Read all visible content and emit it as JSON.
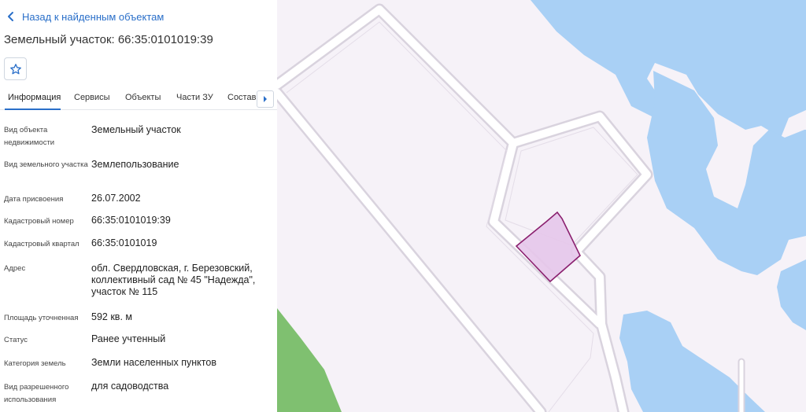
{
  "nav": {
    "back_label": "Назад к найденным объектам"
  },
  "object": {
    "title": "Земельный участок: 66:35:0101019:39"
  },
  "tabs": [
    {
      "label": "Информация",
      "active": true
    },
    {
      "label": "Сервисы"
    },
    {
      "label": "Объекты"
    },
    {
      "label": "Части ЗУ"
    },
    {
      "label": "Состав"
    }
  ],
  "info": [
    {
      "label": "Вид объекта недвижимости",
      "value": "Земельный участок"
    },
    {
      "label": "Вид земельного участка",
      "value": "Землепользование"
    },
    {
      "label": "Дата присвоения",
      "value": "26.07.2002"
    },
    {
      "label": "Кадастровый номер",
      "value": "66:35:0101019:39"
    },
    {
      "label": "Кадастровый квартал",
      "value": "66:35:0101019"
    },
    {
      "label": "Адрес",
      "value": "обл. Свердловская, г. Березовский, коллективный сад № 45 \"Надежда\", участок № 115"
    },
    {
      "label": "Площадь уточненная",
      "value": "592 кв. м"
    },
    {
      "label": "Статус",
      "value": "Ранее учтенный"
    },
    {
      "label": "Категория земель",
      "value": "Земли населенных пунктов"
    },
    {
      "label": "Вид разрешенного использования",
      "value": "для садоводства"
    }
  ],
  "icons": {
    "back": "chevron-left-icon",
    "favorite": "star-icon",
    "tabs_next": "chevron-right-icon"
  },
  "colors": {
    "accent": "#2a6fc9",
    "map_background": "#f6f2f8",
    "water": "#a9d0f5",
    "forest": "#7fc070",
    "road": "#ffffff",
    "road_edge": "#d9d3de",
    "parcel_fill": "#e6c6ea",
    "parcel_stroke": "#8a1f6e"
  }
}
